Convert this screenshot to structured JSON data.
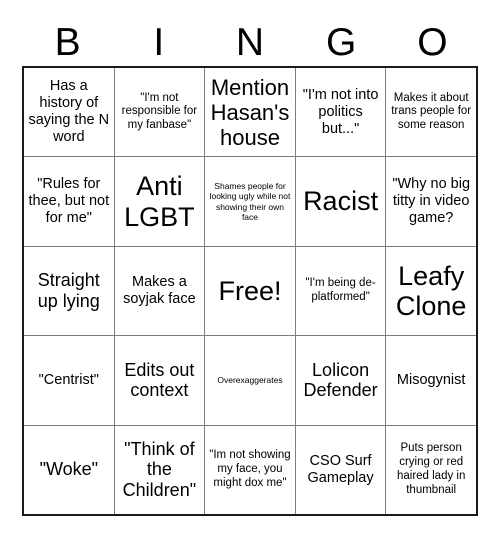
{
  "header": {
    "letters": [
      "B",
      "I",
      "N",
      "G",
      "O"
    ]
  },
  "grid": {
    "rows": [
      [
        {
          "text": "Has a history of saying the N word",
          "size": "fs-md"
        },
        {
          "text": "\"I'm not responsible for my fanbase\"",
          "size": "fs-sm"
        },
        {
          "text": "Mention Hasan's house",
          "size": "fs-xl"
        },
        {
          "text": "\"I'm not into politics but...\"",
          "size": "fs-md"
        },
        {
          "text": "Makes it about trans people for some reason",
          "size": "fs-sm"
        }
      ],
      [
        {
          "text": "\"Rules for thee, but not for me\"",
          "size": "fs-md"
        },
        {
          "text": "Anti LGBT",
          "size": "fs-xxl"
        },
        {
          "text": "Shames people for looking ugly while not showing their own face",
          "size": "fs-xs"
        },
        {
          "text": "Racist",
          "size": "fs-xxl"
        },
        {
          "text": "\"Why no big titty in video game?",
          "size": "fs-md"
        }
      ],
      [
        {
          "text": "Straight up lying",
          "size": "fs-lg"
        },
        {
          "text": "Makes a soyjak face",
          "size": "fs-md"
        },
        {
          "text": "Free!",
          "size": "fs-xxl"
        },
        {
          "text": "\"I'm being de-platformed\"",
          "size": "fs-sm"
        },
        {
          "text": "Leafy Clone",
          "size": "fs-xxl"
        }
      ],
      [
        {
          "text": "\"Centrist\"",
          "size": "fs-md"
        },
        {
          "text": "Edits out context",
          "size": "fs-lg"
        },
        {
          "text": "Overexaggerates",
          "size": "fs-xs"
        },
        {
          "text": "Lolicon Defender",
          "size": "fs-lg"
        },
        {
          "text": "Misogynist",
          "size": "fs-md"
        }
      ],
      [
        {
          "text": "\"Woke\"",
          "size": "fs-lg"
        },
        {
          "text": "\"Think of the Children\"",
          "size": "fs-lg"
        },
        {
          "text": "\"Im not showing my face, you might dox me\"",
          "size": "fs-sm"
        },
        {
          "text": "CSO Surf Gameplay",
          "size": "fs-md"
        },
        {
          "text": "Puts person crying or red haired lady in thumbnail",
          "size": "fs-sm"
        }
      ]
    ]
  },
  "colors": {
    "background": "#ffffff",
    "text": "#000000",
    "outer_border": "#1a1a1a",
    "inner_border": "#7d7d7d"
  }
}
